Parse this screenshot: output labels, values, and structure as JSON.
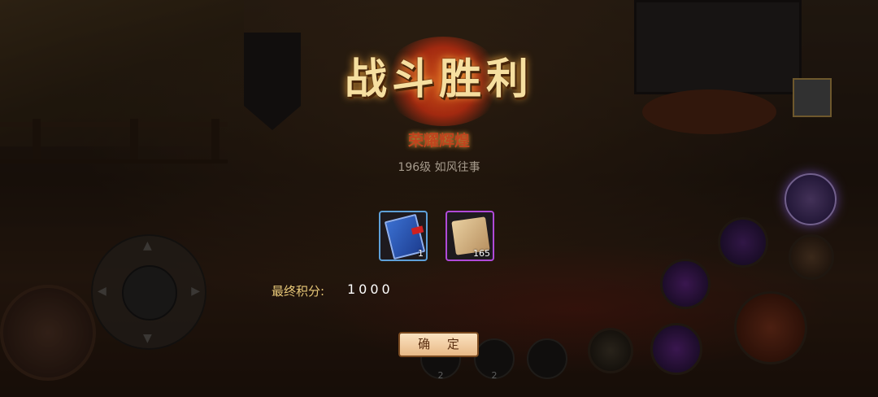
{
  "result": {
    "title": "战斗胜利",
    "subtitle": "荣耀辉煌",
    "player_info": "196级 如风往事"
  },
  "rewards": [
    {
      "name": "book",
      "icon": "book-icon",
      "count": "1",
      "rarity_color": "#5ea0d8"
    },
    {
      "name": "scroll",
      "icon": "scroll-icon",
      "count": "165",
      "rarity_color": "#b04ad8"
    }
  ],
  "score": {
    "label": "最终积分:",
    "value": "1000"
  },
  "confirm_label": "确 定",
  "hud": {
    "slot_counts": [
      "2",
      "2"
    ]
  }
}
